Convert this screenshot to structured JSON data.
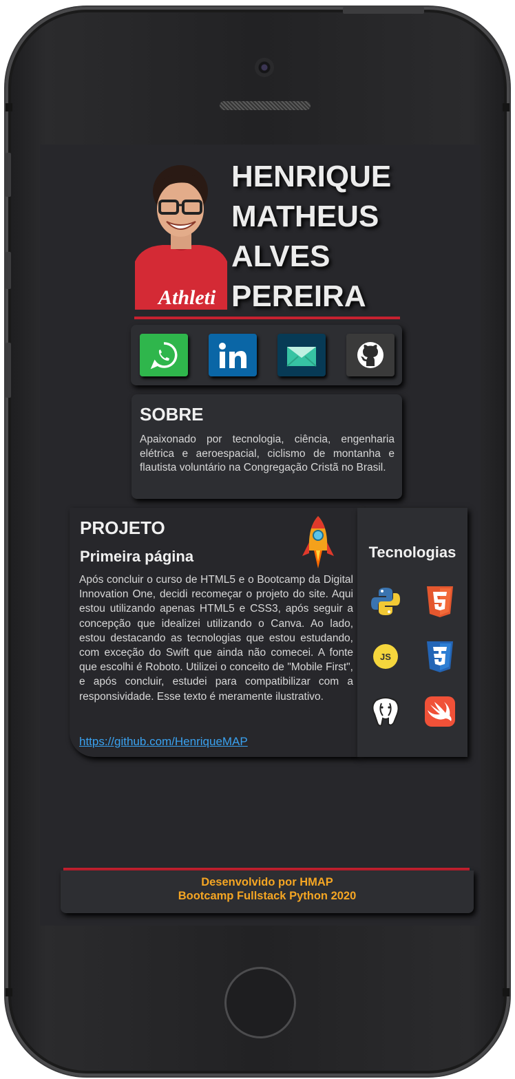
{
  "profile": {
    "name_lines": [
      "HENRIQUE",
      "MATHEUS",
      "ALVES",
      "PEREIRA"
    ],
    "shirt_text": "Athleti"
  },
  "social": {
    "items": [
      {
        "icon": "whatsapp-icon",
        "color": "#2fb64c"
      },
      {
        "icon": "linkedin-icon",
        "color": "#0a66a6"
      },
      {
        "icon": "email-icon",
        "color": "#073a55"
      },
      {
        "icon": "github-icon",
        "color": "#3a3a3a"
      }
    ]
  },
  "sobre": {
    "title": "SOBRE",
    "text": "Apaixonado por tecnologia, ciência, engenharia elétrica e aeroespacial, ciclismo de montanha e flautista voluntário na Congregação Cristã no Brasil."
  },
  "projeto": {
    "title": "PROJETO",
    "subtitle": "Primeira página",
    "text": "Após concluir o curso de HTML5 e o Bootcamp da Digital Innovation One, decidi recomeçar o projeto do site. Aqui estou utilizando apenas HTML5 e CSS3, após seguir a concepção que idealizei utilizando o Canva. Ao lado, estou destacando as tecnologias que estou estudando, com exceção do Swift que ainda não comecei. A fonte que escolhi é Roboto. Utilizei o conceito de \"Mobile First\", e após concluir, estudei para compatibilizar com a responsividade. Esse texto é meramente ilustrativo.",
    "link": "https://github.com/HenriqueMAP"
  },
  "tecnologias": {
    "title": "Tecnologias",
    "items": [
      "python-icon",
      "html5-icon",
      "javascript-icon",
      "css3-icon",
      "postgresql-icon",
      "swift-icon"
    ],
    "js_label": "JS"
  },
  "footer": {
    "line1": "Desenvolvido por HMAP",
    "line2": "Bootcamp Fullstack Python 2020"
  },
  "colors": {
    "accent_red": "#c62130",
    "footer_text": "#f5a623",
    "link": "#3aa2f0"
  }
}
